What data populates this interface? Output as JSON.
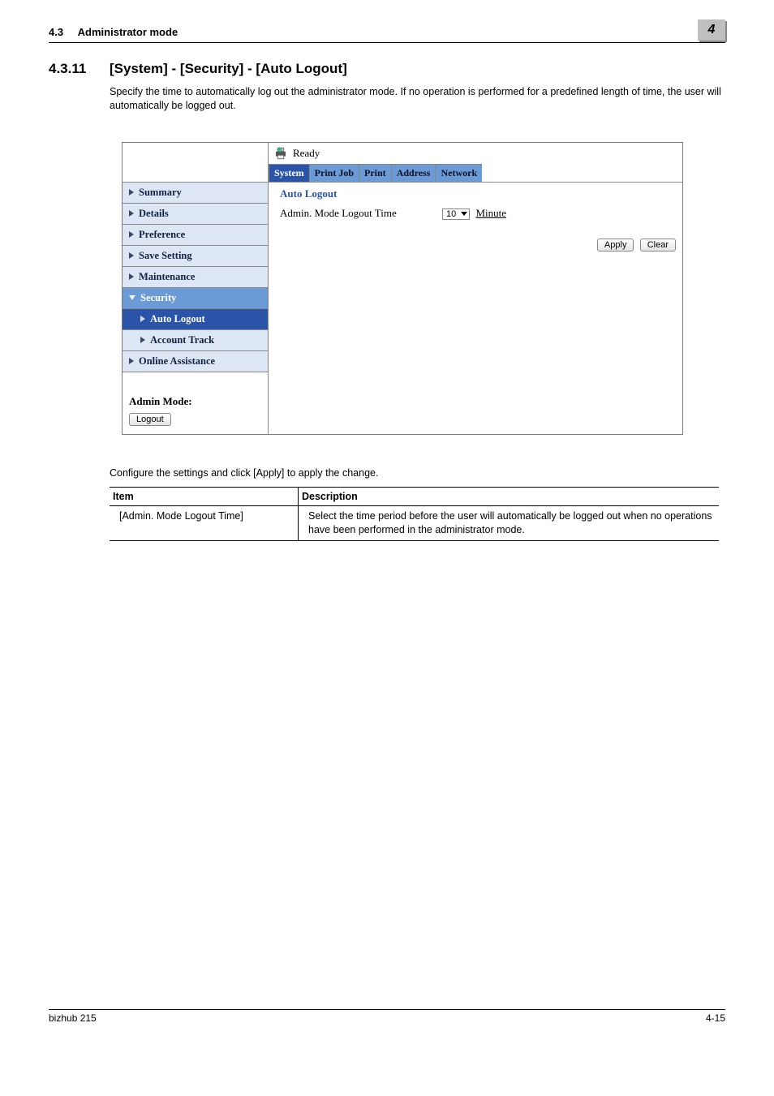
{
  "header": {
    "section_ref": "4.3",
    "section_label": "Administrator mode",
    "chapter_num": "4"
  },
  "section": {
    "num": "4.3.11",
    "title": "[System] - [Security] - [Auto Logout]",
    "intro": "Specify the time to automatically log out the administrator mode. If no operation is performed for a predefined length of time, the user will automatically be logged out."
  },
  "screenshot": {
    "status": "Ready",
    "tabs": [
      "System",
      "Print Job",
      "Print",
      "Address",
      "Network"
    ],
    "nav": {
      "items": [
        {
          "label": "Summary",
          "style": "light",
          "arrow": "right"
        },
        {
          "label": "Details",
          "style": "light",
          "arrow": "right"
        },
        {
          "label": "Preference",
          "style": "light",
          "arrow": "right"
        },
        {
          "label": "Save Setting",
          "style": "light",
          "arrow": "right"
        },
        {
          "label": "Maintenance",
          "style": "light",
          "arrow": "right"
        },
        {
          "label": "Security",
          "style": "dark",
          "arrow": "down"
        },
        {
          "label": "Auto Logout",
          "style": "darker",
          "sub": true,
          "arrow": "right"
        },
        {
          "label": "Account Track",
          "style": "light",
          "sub": true,
          "arrow": "right"
        },
        {
          "label": "Online Assistance",
          "style": "light",
          "arrow": "right"
        }
      ]
    },
    "admin_mode_label": "Admin Mode:",
    "logout_button": "Logout",
    "content": {
      "title": "Auto Logout",
      "field_label": "Admin. Mode Logout Time",
      "select_value": "10",
      "unit": "Minute",
      "apply": "Apply",
      "clear": "Clear"
    }
  },
  "configure_text": "Configure the settings and click [Apply] to apply the change.",
  "table": {
    "head_item": "Item",
    "head_desc": "Description",
    "row_item": "[Admin. Mode Logout Time]",
    "row_desc": "Select the time period before the user will automatically be logged out when no operations have been performed in the administrator mode."
  },
  "footer": {
    "product": "bizhub 215",
    "page": "4-15"
  }
}
